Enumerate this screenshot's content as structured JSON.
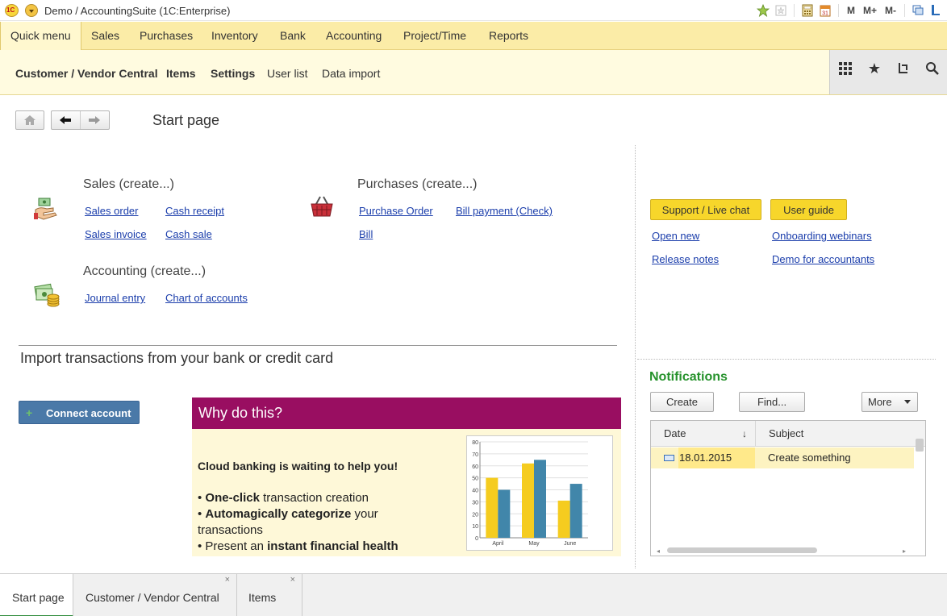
{
  "app": {
    "title": "Demo / AccountingSuite  (1C:Enterprise)"
  },
  "titlebar_buttons": [
    "M",
    "M+",
    "M-"
  ],
  "sections": [
    "Quick menu",
    "Sales",
    "Purchases",
    "Inventory",
    "Bank",
    "Accounting",
    "Project/Time",
    "Reports"
  ],
  "functions": [
    "Customer / Vendor Central",
    "Items",
    "Settings",
    "User list",
    "Data import"
  ],
  "page": {
    "title": "Start page"
  },
  "sales": {
    "title": "Sales (create...)",
    "links": [
      "Sales order",
      "Cash receipt",
      "Sales invoice",
      "Cash sale"
    ]
  },
  "purchases": {
    "title": "Purchases (create...)",
    "links": [
      "Purchase Order",
      "Bill payment (Check)",
      "Bill"
    ]
  },
  "accounting": {
    "title": "Accounting (create...)",
    "links": [
      "Journal entry",
      "Chart of accounts"
    ]
  },
  "import": {
    "title": "Import transactions from your bank or credit card",
    "connect_label": "Connect account",
    "why_title": "Why do this?",
    "headline": "Cloud banking is waiting to help you!",
    "bullet1_bold": "One-click",
    "bullet1_rest": " transaction creation",
    "bullet2_bold": "Automagically categorize",
    "bullet2_rest": " your",
    "bullet2_cont": "transactions",
    "bullet3_pre": "Present an ",
    "bullet3_bold": "instant financial health"
  },
  "chart_data": {
    "type": "bar",
    "categories": [
      "April",
      "May",
      "June"
    ],
    "series": [
      {
        "color": "#f5cc1f",
        "values": [
          50,
          62,
          31
        ]
      },
      {
        "color": "#4186aa",
        "values": [
          40,
          65,
          45
        ]
      }
    ],
    "ylim": [
      0,
      80
    ],
    "yticks": [
      0,
      10,
      20,
      30,
      40,
      50,
      60,
      70,
      80
    ],
    "grid": true
  },
  "support": {
    "live_chat": "Support / Live chat",
    "user_guide": "User guide",
    "links": [
      "Open new",
      "Onboarding webinars",
      "Release notes",
      "Demo for accountants"
    ]
  },
  "notifications": {
    "title": "Notifications",
    "create": "Create",
    "find": "Find...",
    "more": "More",
    "columns": [
      "Date",
      "Subject"
    ],
    "rows": [
      {
        "date": "18.01.2015",
        "subject": "Create something"
      }
    ]
  },
  "tabs": [
    "Start page",
    "Customer / Vendor Central",
    "Items"
  ],
  "colors": {
    "section_bar": "#fbeca7",
    "accent_green": "#26922c",
    "why_header": "#990e61",
    "support_button": "#f7d62b"
  }
}
